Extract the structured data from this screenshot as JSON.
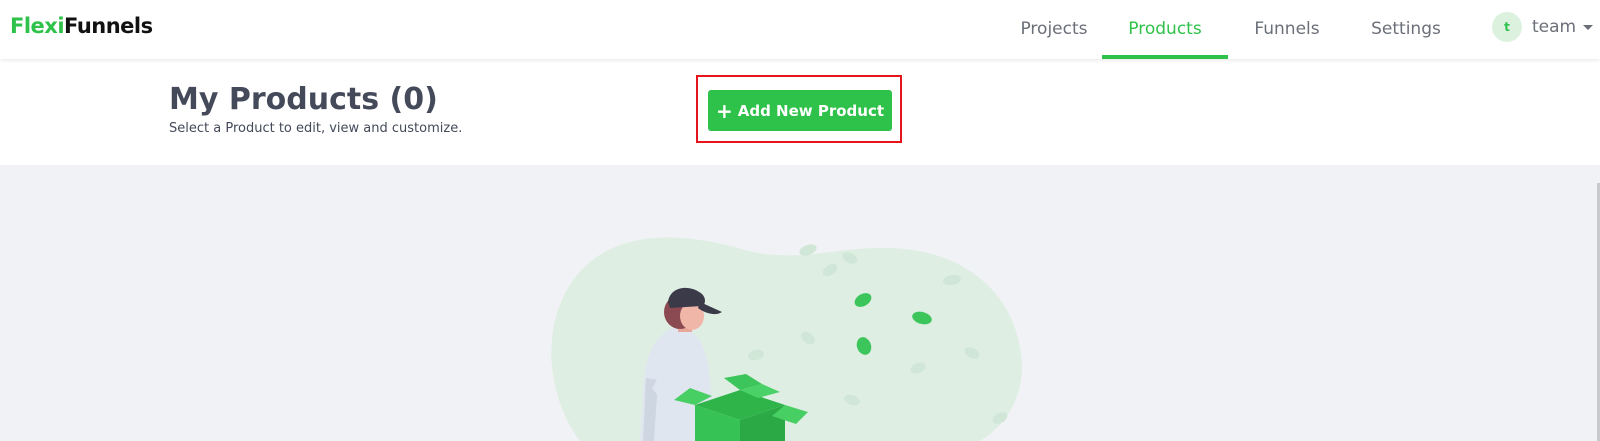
{
  "logo": {
    "part1": "Flexi",
    "part2": "Funnels"
  },
  "nav": {
    "items": [
      {
        "label": "Projects",
        "active": false
      },
      {
        "label": "Products",
        "active": true
      },
      {
        "label": "Funnels",
        "active": false
      },
      {
        "label": "Settings",
        "active": false
      }
    ],
    "user": {
      "initial": "t",
      "name": "team"
    }
  },
  "page": {
    "title": "My Products (0)",
    "subtitle": "Select a Product to edit, view and customize.",
    "add_button_label": "Add New Product"
  },
  "colors": {
    "accent": "#2ec24a",
    "highlight": "#e5151b",
    "text": "#444a5a",
    "muted": "#6b6f78"
  },
  "icons": {
    "add": "plus-icon",
    "user_menu": "caret-down-icon"
  }
}
